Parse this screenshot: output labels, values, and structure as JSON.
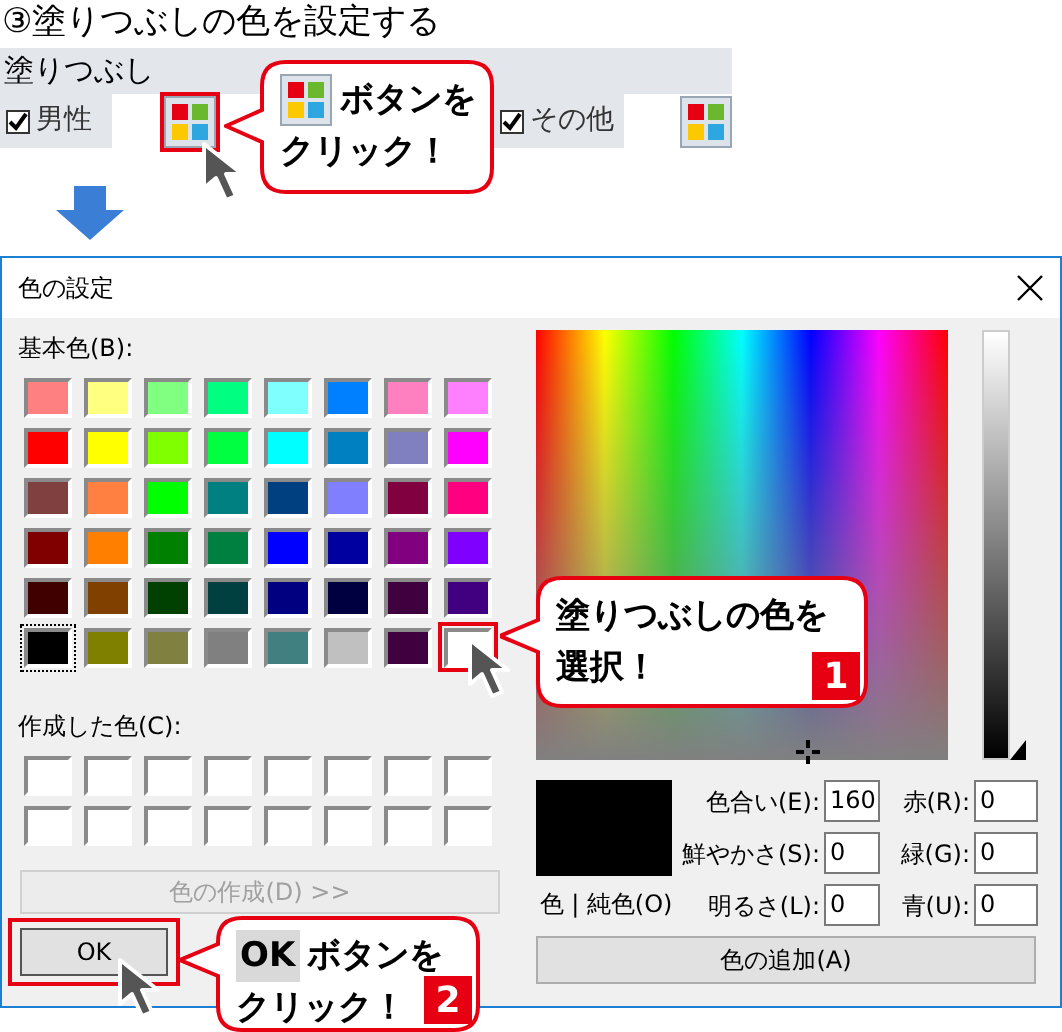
{
  "heading": "③塗りつぶしの色を設定する",
  "fill_panel": {
    "title": "塗りつぶし",
    "options": [
      {
        "label": "男性",
        "checked": true
      },
      {
        "label": "その他",
        "checked": true
      }
    ]
  },
  "callout_button": {
    "lines": [
      "ボタンを",
      "クリック！"
    ]
  },
  "dialog": {
    "title": "色の設定",
    "basic_label": "基本色(B):",
    "basic_colors": [
      {
        "color": "#ff8080",
        "selected": false,
        "highlighted": false
      },
      {
        "color": "#ffff80",
        "selected": false,
        "highlighted": false
      },
      {
        "color": "#80ff80",
        "selected": false,
        "highlighted": false
      },
      {
        "color": "#00ff80",
        "selected": false,
        "highlighted": false
      },
      {
        "color": "#80ffff",
        "selected": false,
        "highlighted": false
      },
      {
        "color": "#0080ff",
        "selected": false,
        "highlighted": false
      },
      {
        "color": "#ff80c0",
        "selected": false,
        "highlighted": false
      },
      {
        "color": "#ff80ff",
        "selected": false,
        "highlighted": false
      },
      {
        "color": "#ff0000",
        "selected": false,
        "highlighted": false
      },
      {
        "color": "#ffff00",
        "selected": false,
        "highlighted": false
      },
      {
        "color": "#80ff00",
        "selected": false,
        "highlighted": false
      },
      {
        "color": "#00ff40",
        "selected": false,
        "highlighted": false
      },
      {
        "color": "#00ffff",
        "selected": false,
        "highlighted": false
      },
      {
        "color": "#0080c0",
        "selected": false,
        "highlighted": false
      },
      {
        "color": "#8080c0",
        "selected": false,
        "highlighted": false
      },
      {
        "color": "#ff00ff",
        "selected": false,
        "highlighted": false
      },
      {
        "color": "#804040",
        "selected": false,
        "highlighted": false
      },
      {
        "color": "#ff8040",
        "selected": false,
        "highlighted": false
      },
      {
        "color": "#00ff00",
        "selected": false,
        "highlighted": false
      },
      {
        "color": "#008080",
        "selected": false,
        "highlighted": false
      },
      {
        "color": "#004080",
        "selected": false,
        "highlighted": false
      },
      {
        "color": "#8080ff",
        "selected": false,
        "highlighted": false
      },
      {
        "color": "#800040",
        "selected": false,
        "highlighted": false
      },
      {
        "color": "#ff0080",
        "selected": false,
        "highlighted": false
      },
      {
        "color": "#800000",
        "selected": false,
        "highlighted": false
      },
      {
        "color": "#ff8000",
        "selected": false,
        "highlighted": false
      },
      {
        "color": "#008000",
        "selected": false,
        "highlighted": false
      },
      {
        "color": "#008040",
        "selected": false,
        "highlighted": false
      },
      {
        "color": "#0000ff",
        "selected": false,
        "highlighted": false
      },
      {
        "color": "#0000a0",
        "selected": false,
        "highlighted": false
      },
      {
        "color": "#800080",
        "selected": false,
        "highlighted": false
      },
      {
        "color": "#8000ff",
        "selected": false,
        "highlighted": false
      },
      {
        "color": "#400000",
        "selected": false,
        "highlighted": false
      },
      {
        "color": "#804000",
        "selected": false,
        "highlighted": false
      },
      {
        "color": "#004000",
        "selected": false,
        "highlighted": false
      },
      {
        "color": "#004040",
        "selected": false,
        "highlighted": false
      },
      {
        "color": "#000080",
        "selected": false,
        "highlighted": false
      },
      {
        "color": "#000040",
        "selected": false,
        "highlighted": false
      },
      {
        "color": "#400040",
        "selected": false,
        "highlighted": false
      },
      {
        "color": "#400080",
        "selected": false,
        "highlighted": false
      },
      {
        "color": "#000000",
        "selected": true,
        "highlighted": false
      },
      {
        "color": "#808000",
        "selected": false,
        "highlighted": false
      },
      {
        "color": "#808040",
        "selected": false,
        "highlighted": false
      },
      {
        "color": "#808080",
        "selected": false,
        "highlighted": false
      },
      {
        "color": "#408080",
        "selected": false,
        "highlighted": false
      },
      {
        "color": "#c0c0c0",
        "selected": false,
        "highlighted": false
      },
      {
        "color": "#400040",
        "selected": false,
        "highlighted": false
      },
      {
        "color": "#ffffff",
        "selected": false,
        "highlighted": true
      }
    ],
    "custom_label": "作成した色(C):",
    "custom_colors": [
      {
        "color": "#ffffff"
      },
      {
        "color": "#ffffff"
      },
      {
        "color": "#ffffff"
      },
      {
        "color": "#ffffff"
      },
      {
        "color": "#ffffff"
      },
      {
        "color": "#ffffff"
      },
      {
        "color": "#ffffff"
      },
      {
        "color": "#ffffff"
      },
      {
        "color": "#ffffff"
      },
      {
        "color": "#ffffff"
      },
      {
        "color": "#ffffff"
      },
      {
        "color": "#ffffff"
      },
      {
        "color": "#ffffff"
      },
      {
        "color": "#ffffff"
      },
      {
        "color": "#ffffff"
      },
      {
        "color": "#ffffff"
      }
    ],
    "define_button": {
      "label": "色の作成(D) >>",
      "disabled": true
    },
    "ok_button": {
      "label": "OK"
    },
    "preview_label": "色 | 純色(O)",
    "hsl_fields": [
      {
        "label": "色合い(E):",
        "value": "160"
      },
      {
        "label": "鮮やかさ(S):",
        "value": "0"
      },
      {
        "label": "明るさ(L):",
        "value": "0"
      }
    ],
    "rgb_fields": [
      {
        "label": "赤(R):",
        "value": "0"
      },
      {
        "label": "緑(G):",
        "value": "0"
      },
      {
        "label": "青(U):",
        "value": "0"
      }
    ],
    "add_button": {
      "label": "色の追加(A)"
    }
  },
  "callout_select": {
    "lines": [
      "塗りつぶしの色を",
      "選択！"
    ],
    "badge": "1"
  },
  "callout_ok": {
    "label": "OK",
    "lines": [
      "ボタンを",
      "クリック！"
    ],
    "badge": "2"
  }
}
